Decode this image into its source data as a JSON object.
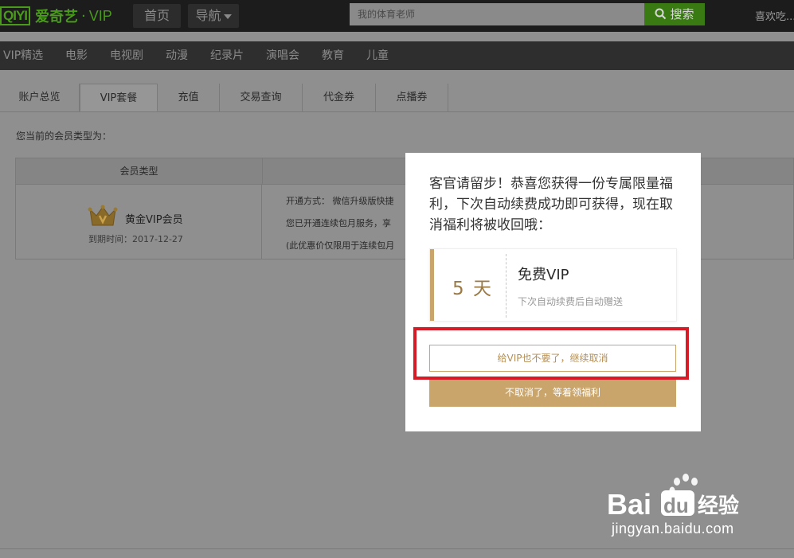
{
  "header": {
    "logo": {
      "mark": "QIYI",
      "name": "爱奇艺",
      "dot": "·",
      "vip": "VIP"
    },
    "nav_home": "首页",
    "nav_guide": "导航",
    "search_placeholder": "我的体育老师",
    "search_button": "搜索",
    "welcome": "喜欢吃..."
  },
  "categories": [
    "VIP精选",
    "电影",
    "电视剧",
    "动漫",
    "纪录片",
    "演唱会",
    "教育",
    "儿童"
  ],
  "tabs": [
    {
      "label": "账户总览",
      "active": false
    },
    {
      "label": "VIP套餐",
      "active": true
    },
    {
      "label": "充值",
      "active": false
    },
    {
      "label": "交易查询",
      "active": false
    },
    {
      "label": "代金券",
      "active": false
    },
    {
      "label": "点播券",
      "active": false
    }
  ],
  "member": {
    "label": "您当前的会员类型为：",
    "column_header": "会员类型",
    "type": "黄金VIP会员",
    "expiry": "到期时间：2017-12-27",
    "details": [
      "开通方式： 微信升级版快捷",
      "您已开通连续包月服务，享",
      "(此优惠价仅限用于连续包月"
    ]
  },
  "modal": {
    "message": "客官请留步！恭喜您获得一份专属限量福利，下次自动续费成功即可获得，现在取消福利将被收回哦：",
    "coupon": {
      "days": "5 天",
      "title": "免费VIP",
      "subtitle": "下次自动续费后自动赠送"
    },
    "continue_cancel_button": "给VIP也不要了，继续取消",
    "keep_button": "不取消了，等着领福利"
  },
  "watermark": {
    "brand_left": "Bai",
    "brand_right": "经验",
    "url": "jingyan.baidu.com"
  },
  "colors": {
    "brand_green": "#4a9a1c",
    "gold": "#c9a46b",
    "highlight_red": "#d61b27"
  }
}
